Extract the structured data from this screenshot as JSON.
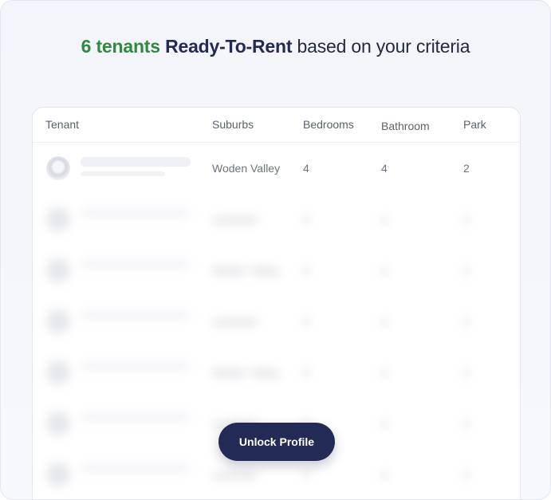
{
  "headline": {
    "count_text": "6 tenants",
    "highlight_text": "Ready-To-Rent",
    "rest_text": "based on your criteria"
  },
  "table": {
    "columns": [
      "Tenant",
      "Suburbs",
      "Bedrooms",
      "Bathroom",
      "Park"
    ],
    "first_row": {
      "suburb": "Woden Valley",
      "bedrooms": "4",
      "bathrooms": "4",
      "park": "2"
    },
    "blurred_rows": [
      {
        "suburb": "Lyneham",
        "bedrooms": "4",
        "bathrooms": "4",
        "park": "2"
      },
      {
        "suburb": "Woden Valley",
        "bedrooms": "4",
        "bathrooms": "4",
        "park": "2"
      },
      {
        "suburb": "Lyneham",
        "bedrooms": "4",
        "bathrooms": "4",
        "park": "2"
      },
      {
        "suburb": "Woden Valley",
        "bedrooms": "4",
        "bathrooms": "4",
        "park": "2"
      },
      {
        "suburb": "Lyneham",
        "bedrooms": "4",
        "bathrooms": "4",
        "park": "2"
      },
      {
        "suburb": "Lyneham",
        "bedrooms": "4",
        "bathrooms": "4",
        "park": "2"
      }
    ]
  },
  "cta": {
    "label": "Unlock Profile"
  }
}
